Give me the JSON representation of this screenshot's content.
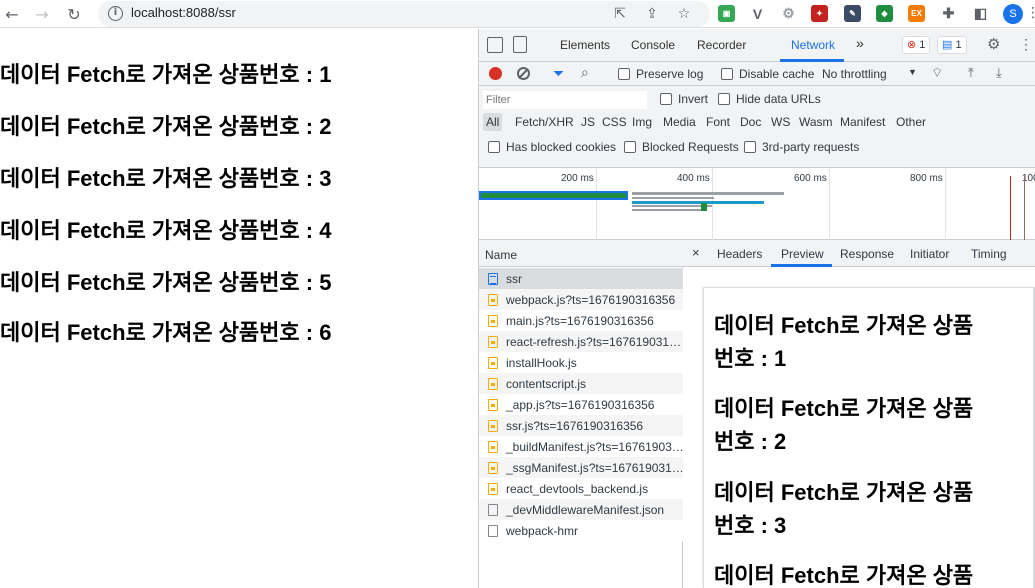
{
  "browser": {
    "url": "localhost:8088/ssr",
    "profile_initial": "S"
  },
  "products": [
    "데이터 Fetch로 가져온 상품번호 : 1",
    "데이터 Fetch로 가져온 상품번호 : 2",
    "데이터 Fetch로 가져온 상품번호 : 3",
    "데이터 Fetch로 가져온 상품번호 : 4",
    "데이터 Fetch로 가져온 상품번호 : 5",
    "데이터 Fetch로 가져온 상품번호 : 6"
  ],
  "devtools": {
    "tabs": [
      "Elements",
      "Console",
      "Recorder",
      "Network"
    ],
    "active_tab": "Network",
    "error_count": "1",
    "message_count": "1",
    "toolbar": {
      "preserve_log": "Preserve log",
      "disable_cache": "Disable cache",
      "throttling": "No throttling"
    },
    "filter_placeholder": "Filter",
    "invert": "Invert",
    "hide_data_urls": "Hide data URLs",
    "type_filters": [
      "All",
      "Fetch/XHR",
      "JS",
      "CSS",
      "Img",
      "Media",
      "Font",
      "Doc",
      "WS",
      "Wasm",
      "Manifest",
      "Other"
    ],
    "blocked_cookies": "Has blocked cookies",
    "blocked_requests": "Blocked Requests",
    "third_party": "3rd-party requests",
    "overview_ticks": [
      "200 ms",
      "400 ms",
      "600 ms",
      "800 ms",
      "100"
    ],
    "name_header": "Name",
    "requests": [
      {
        "name": "ssr",
        "type": "doc"
      },
      {
        "name": "webpack.js?ts=1676190316356",
        "type": "js"
      },
      {
        "name": "main.js?ts=1676190316356",
        "type": "js"
      },
      {
        "name": "react-refresh.js?ts=167619031…",
        "type": "js"
      },
      {
        "name": "installHook.js",
        "type": "js"
      },
      {
        "name": "contentscript.js",
        "type": "js"
      },
      {
        "name": "_app.js?ts=1676190316356",
        "type": "js"
      },
      {
        "name": "ssr.js?ts=1676190316356",
        "type": "js"
      },
      {
        "name": "_buildManifest.js?ts=16761903…",
        "type": "js"
      },
      {
        "name": "_ssgManifest.js?ts=167619031…",
        "type": "js"
      },
      {
        "name": "react_devtools_backend.js",
        "type": "js"
      },
      {
        "name": "_devMiddlewareManifest.json",
        "type": "other"
      },
      {
        "name": "webpack-hmr",
        "type": "other"
      }
    ],
    "detail_tabs": [
      "Headers",
      "Preview",
      "Response",
      "Initiator",
      "Timing"
    ],
    "active_detail_tab": "Preview",
    "preview_lines": [
      {
        "line1": "데이터 Fetch로 가져온 상품",
        "line2": "번호 : 1"
      },
      {
        "line1": "데이터 Fetch로 가져온 상품",
        "line2": "번호 : 2"
      },
      {
        "line1": "데이터 Fetch로 가져온 상품",
        "line2": "번호 : 3"
      },
      {
        "line1": "데이터 Fetch로 가져온 상품",
        "line2": ""
      }
    ]
  }
}
